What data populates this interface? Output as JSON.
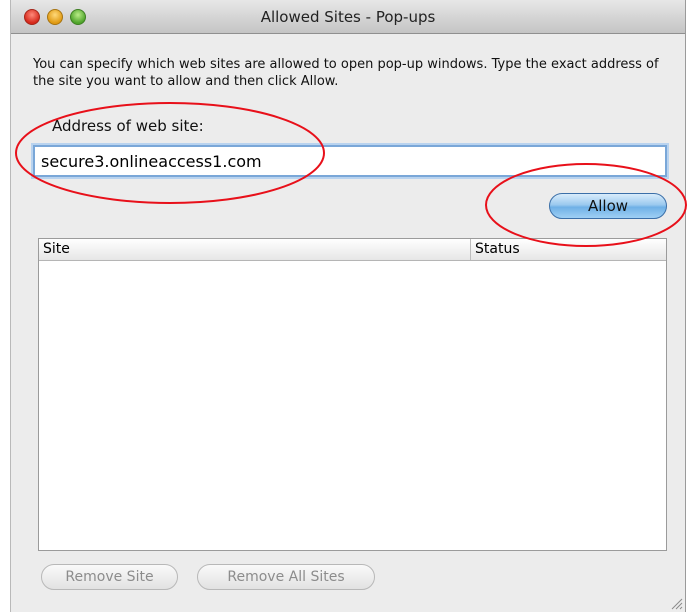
{
  "window": {
    "title": "Allowed Sites - Pop-ups"
  },
  "description": "You can specify which web sites are allowed to open pop-up windows. Type the exact address of the site you want to allow and then click Allow.",
  "address": {
    "label": "Address of web site:",
    "value": "secure3.onlineaccess1.com"
  },
  "allow_button": "Allow",
  "table": {
    "columns": [
      "Site",
      "Status"
    ],
    "rows": []
  },
  "footer": {
    "remove_site": "Remove Site",
    "remove_all_sites": "Remove All Sites"
  },
  "colors": {
    "annotation": "#e8101a",
    "focus_ring": "#7aa7d8",
    "allow_button": "#6fb0e6"
  }
}
